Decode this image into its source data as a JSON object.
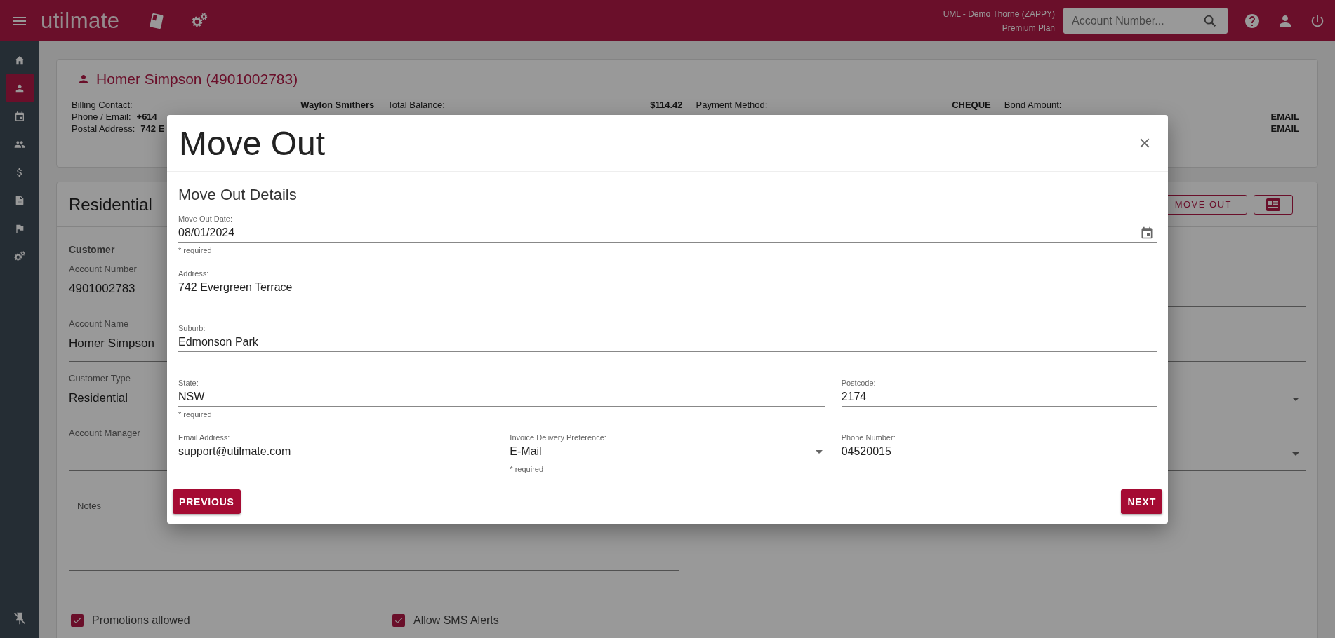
{
  "top_bar": {
    "logo": "utilmate",
    "account": "UML - Demo Thorne (ZAPPY)",
    "plan": "Premium Plan",
    "search": {
      "placeholder": "Account Number..."
    }
  },
  "sidebar": {
    "items": [
      {
        "kind": "home",
        "selected": false
      },
      {
        "kind": "person",
        "selected": true
      },
      {
        "kind": "calendar",
        "selected": false
      },
      {
        "kind": "group",
        "selected": false
      },
      {
        "kind": "dollar",
        "selected": false
      },
      {
        "kind": "document",
        "selected": false
      },
      {
        "kind": "flag",
        "selected": false
      },
      {
        "kind": "gears",
        "selected": false
      }
    ]
  },
  "customer_header": {
    "name": "Homer Simpson (4901002783)",
    "columns": [
      {
        "rows": [
          {
            "label": "Billing Contact:",
            "value": "Waylon Smithers",
            "kind": "right"
          },
          {
            "label": "Phone / Email:",
            "value": "+614",
            "kind": "inline"
          },
          {
            "label": "Postal Address:",
            "value": "742 E",
            "kind": "inline"
          }
        ]
      },
      {
        "rows": [
          {
            "label": "Total Balance:",
            "value": "$114.42",
            "kind": "right"
          }
        ]
      },
      {
        "rows": [
          {
            "label": "Payment Method:",
            "value": "CHEQUE",
            "kind": "right"
          }
        ]
      },
      {
        "rows": [
          {
            "label": "Bond Amount:"
          },
          {
            "value": "EMAIL",
            "kind": "right"
          },
          {
            "value": "EMAIL",
            "kind": "right"
          }
        ]
      }
    ]
  },
  "account_card": {
    "title": "Residential",
    "move_out_button": "MOVE OUT",
    "section": "Customer",
    "left_fields": [
      {
        "label": "Account Number",
        "value": "4901002783",
        "kind": "readonly"
      },
      {
        "label": "Account Name",
        "value": "Homer Simpson",
        "kind": "text"
      },
      {
        "label": "Customer Type",
        "value": "Residential",
        "kind": "text"
      },
      {
        "label": "Account Manager",
        "kind": "text"
      }
    ],
    "right_fields": [
      {
        "kind": "text"
      },
      {
        "kind": "text"
      },
      {
        "kind": "select"
      },
      {
        "kind": "select"
      }
    ],
    "notes": {
      "label": "Notes"
    },
    "checkboxes": [
      {
        "label": "Promotions allowed",
        "checked": true
      },
      {
        "label": "Allow SMS Alerts",
        "checked": true
      }
    ]
  },
  "dialog": {
    "title": "Move Out",
    "subtitle": "Move Out Details",
    "rows": [
      [
        {
          "label": "Move Out Date:",
          "value": "08/01/2024",
          "kind": "date",
          "hint": "* required"
        }
      ],
      [
        {
          "label": "Address:",
          "value": "742 Evergreen Terrace",
          "kind": "text"
        }
      ],
      [
        {
          "label": "Suburb:",
          "value": "Edmonson Park",
          "kind": "text"
        }
      ],
      [
        {
          "label": "State:",
          "value": "NSW",
          "kind": "text",
          "hint": "* required"
        },
        "",
        {
          "label": "Postcode:",
          "value": "2174",
          "kind": "text"
        }
      ],
      [
        {
          "label": "Email Address:",
          "value": "support@utilmate.com",
          "kind": "text"
        },
        {
          "label": "Invoice Delivery Preference:",
          "value": "E-Mail",
          "kind": "select",
          "hint": "* required"
        },
        {
          "label": "Phone Number:",
          "value": "04520015",
          "kind": "text"
        }
      ]
    ],
    "buttons": {
      "previous": "PREVIOUS",
      "next": "NEXT"
    }
  }
}
